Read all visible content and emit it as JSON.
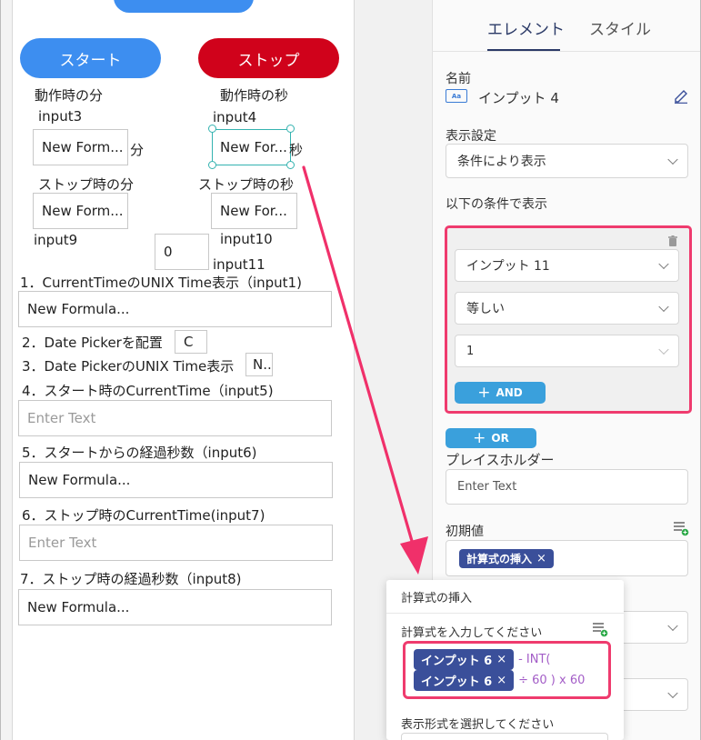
{
  "canvas": {
    "start_label": "スタート",
    "stop_label": "ストップ",
    "start_color": "#3d8ef0",
    "stop_color": "#d0021b",
    "min_label": "動作時の分",
    "sec_label": "動作時の秒",
    "input3": "input3",
    "input4": "input4",
    "formula_trunc": "New Form...",
    "formula_trunc_short": "New For...",
    "min_unit": "分",
    "sec_unit": "秒",
    "stop_min_label": "ストップ時の分",
    "stop_sec_label": "ストップ時の秒",
    "input9": "input9",
    "input10": "input10",
    "input11": "input11",
    "zero_value": "0",
    "item1": "1．CurrentTimeのUNIX Time表示（input1)",
    "formula_full": "New Formula...",
    "item2": "2．Date Pickerを配置",
    "item2_value": "C",
    "item3": "3．Date PickerのUNIX Time表示",
    "item3_value": "N..",
    "item4": "4．スタート時のCurrentTime（input5)",
    "enter_text": "Enter Text",
    "item5": "5．スタートからの経過秒数（input6)",
    "item6": "6．ストップ時のCurrentTime(input7)",
    "item7": "7．ストップ時の経過秒数（input8)"
  },
  "panel": {
    "tab_element": "エレメント",
    "tab_style": "スタイル",
    "name_label": "名前",
    "name_value": "インプット 4",
    "name_icon": "text-input-icon",
    "display_label": "表示設定",
    "display_value": "条件により表示",
    "condition_label": "以下の条件で表示",
    "cond_field": "インプット 11",
    "cond_op": "等しい",
    "cond_value": "1",
    "and_label": "AND",
    "or_label": "OR",
    "placeholder_label": "プレイスホルダー",
    "placeholder_value": "Enter Text",
    "initial_label": "初期値",
    "initial_chip": "計算式の挿入"
  },
  "popup": {
    "title": "計算式の挿入",
    "prompt": "計算式を入力してください",
    "chip1": "インプット 6",
    "op1": "- INT(",
    "chip2": "インプット 6",
    "op2": "÷ 60 ) x 60",
    "format_label": "表示形式を選択してください"
  }
}
